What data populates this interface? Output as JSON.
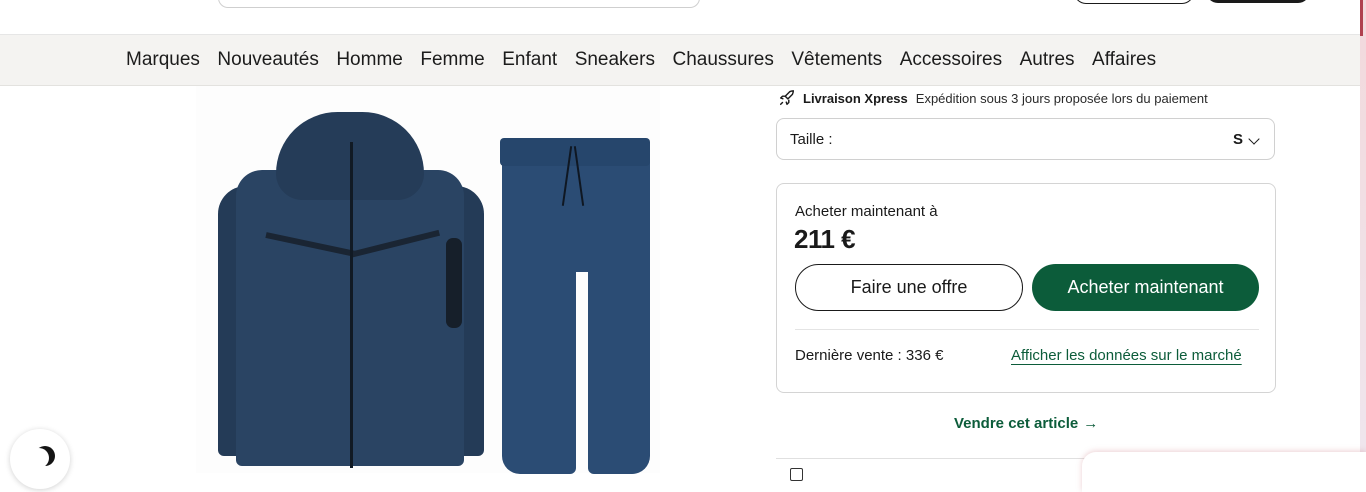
{
  "nav": {
    "items": [
      "Marques",
      "Nouveautés",
      "Homme",
      "Femme",
      "Enfant",
      "Sneakers",
      "Chaussures",
      "Vêtements",
      "Accessoires",
      "Autres",
      "Affaires"
    ]
  },
  "delivery": {
    "icon": "rocket-icon",
    "brand": "Livraison Xpress",
    "description": "Expédition sous 3 jours proposée lors du paiement"
  },
  "size_selector": {
    "label": "Taille :",
    "value": "S",
    "icon": "chevron-down-icon"
  },
  "purchase": {
    "label": "Acheter maintenant à",
    "price": "211 €",
    "offer_button": "Faire une offre",
    "buy_button": "Acheter maintenant",
    "last_sale": "Dernière vente : 336 €",
    "market_link": "Afficher les données sur le marché"
  },
  "sell": {
    "label": "Vendre cet article",
    "icon": "arrow-right-icon",
    "arrow": "→"
  },
  "theme_toggle": {
    "icon": "moon-icon"
  },
  "colors": {
    "accent_green": "#0c5c3a",
    "nav_background": "#f4f3f1",
    "product_navy": "#2a4463"
  }
}
